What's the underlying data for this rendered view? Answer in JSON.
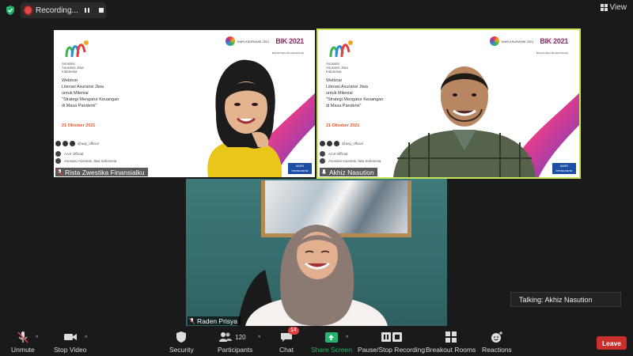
{
  "top": {
    "recording_label": "Recording...",
    "view_label": "View"
  },
  "slides": {
    "org_lines": [
      "Asosiasi",
      "Asuransi Jiwa",
      "Indonesia"
    ],
    "sponsor_text": "HARI ASURANSI 2021",
    "sponsor_brand": "BIK 2021",
    "sponsor_sub": "BULAN INKLUSI KEUANGAN",
    "webinar_lines": [
      "Webinar",
      "Literasi Asuransi Jiwa",
      "untuk Milenial",
      "\"Strategi Mengatur Keuangan",
      "di Masa Pandemi\""
    ],
    "date": "21 Oktober 2021",
    "social_handle": "@aaji_official",
    "contact_1": "AAJI Official",
    "contact_2": "Asosiasi Asuransi Jiwa Indonesia",
    "mari_lines": [
      "MARI",
      "berasuransi"
    ]
  },
  "participants": [
    {
      "name": "Rista Zwestika Finansialku"
    },
    {
      "name": "Akhiz Nasution"
    },
    {
      "name": "Raden Prisya"
    }
  ],
  "talking": "Talking: Akhiz Nasution",
  "toolbar": {
    "unmute": "Unmute",
    "stop_video": "Stop Video",
    "security": "Security",
    "participants": "Participants",
    "participants_count": "120",
    "chat": "Chat",
    "chat_badge": "14",
    "share_screen": "Share Screen",
    "record": "Pause/Stop Recording",
    "breakout": "Breakout Rooms",
    "reactions": "Reactions",
    "leave": "Leave"
  },
  "colors": {
    "active_speaker": "#c8e65a",
    "share_green": "#23b36a",
    "leave_red": "#c9302c",
    "rec_red": "#e04646"
  }
}
